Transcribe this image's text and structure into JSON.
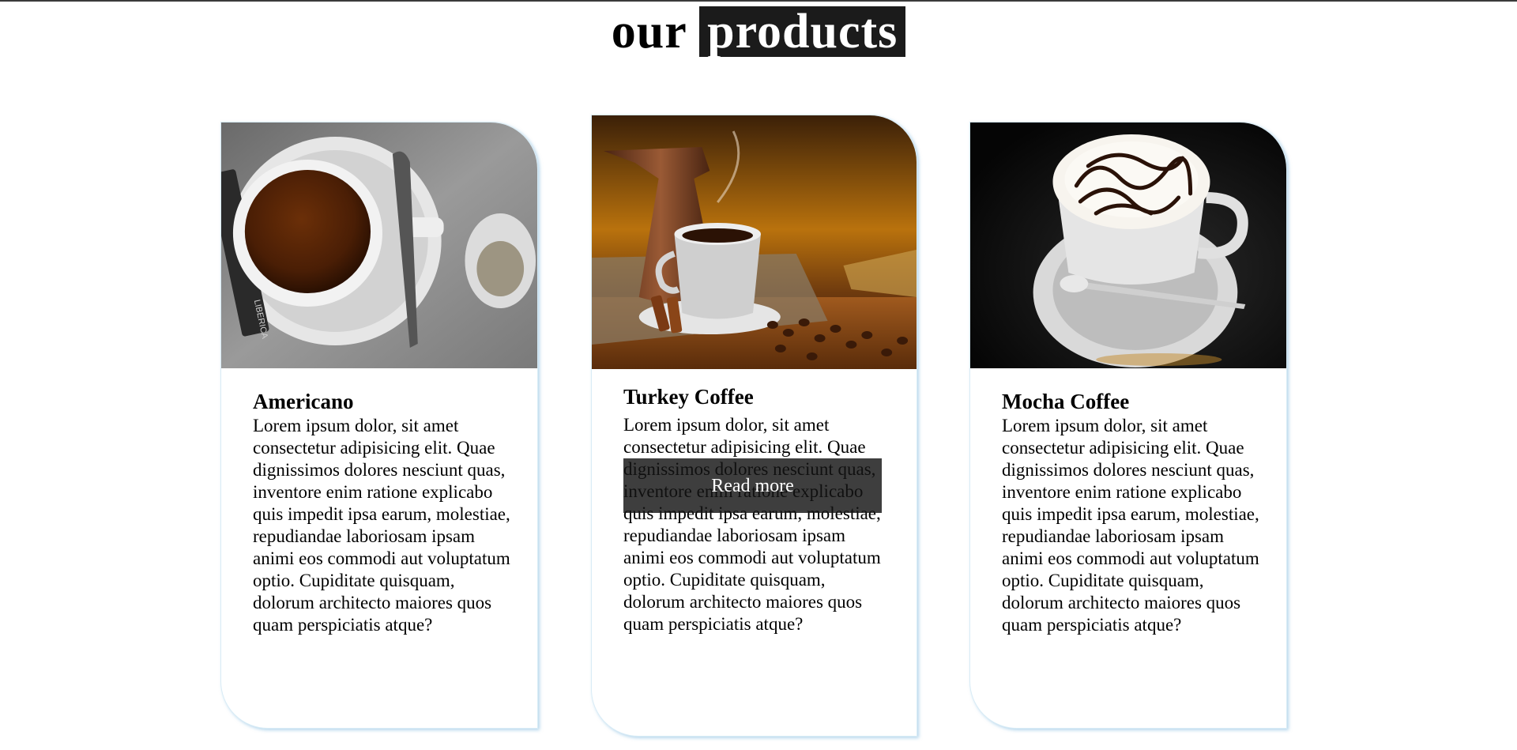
{
  "heading": {
    "word1": "our",
    "word2": "products"
  },
  "products": [
    {
      "name": "Americano",
      "description": "Lorem ipsum dolor, sit amet consectetur adipisicing elit. Quae dignissimos dolores nesciunt quas, inventore enim ratione explicabo quis impedit ipsa earum, molestiae, repudiandae laboriosam ipsam animi eos commodi aut voluptatum optio. Cupiditate quisquam, dolorum architecto maiores quos quam perspiciatis atque?",
      "image": "americano-coffee-cup-photo",
      "sachet_text": "LIBERICA"
    },
    {
      "name": "Turkey Coffee",
      "description": "Lorem ipsum dolor, sit amet consectetur adipisicing elit. Quae dignissimos dolores nesciunt quas, inventore enim ratione explicabo quis impedit ipsa earum, molestiae, repudiandae laboriosam ipsam animi eos commodi aut voluptatum optio. Cupiditate quisquam, dolorum architecto maiores quos quam perspiciatis atque?",
      "image": "turkish-coffee-cezve-photo",
      "button_label": "Read more"
    },
    {
      "name": "Mocha Coffee",
      "description": "Lorem ipsum dolor, sit amet consectetur adipisicing elit. Quae dignissimos dolores nesciunt quas, inventore enim ratione explicabo quis impedit ipsa earum, molestiae, repudiandae laboriosam ipsam animi eos commodi aut voluptatum optio. Cupiditate quisquam, dolorum architecto maiores quos quam perspiciatis atque?",
      "image": "mocha-whipped-cream-photo"
    }
  ],
  "colors": {
    "heading_highlight_bg": "#1b1b1b",
    "card_border": "#d9ecf6",
    "button_bg": "#141414"
  }
}
